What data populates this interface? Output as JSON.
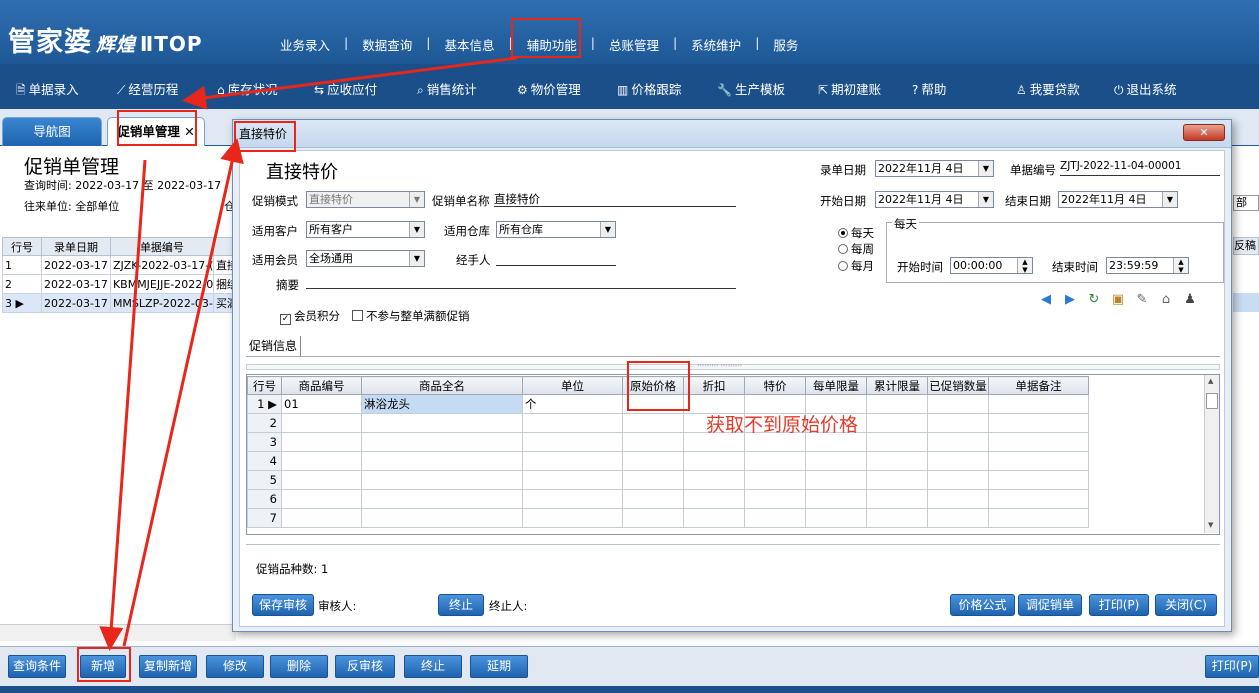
{
  "app": {
    "logo_main": "管家婆",
    "logo_sub": "辉煌",
    "logo_sub2": "ⅡTOP",
    "top_menu": [
      "业务录入",
      "数据查询",
      "基本信息",
      "辅助功能",
      "总账管理",
      "系统维护",
      "服务"
    ]
  },
  "toolbar": {
    "items": [
      {
        "icon": "document-icon",
        "label": "单据录入"
      },
      {
        "icon": "chart-icon",
        "label": "经营历程"
      },
      {
        "icon": "home-icon",
        "label": "库存状况"
      },
      {
        "icon": "transfer-icon",
        "label": "应收应付"
      },
      {
        "icon": "search-icon",
        "label": "销售统计"
      },
      {
        "icon": "gear-icon",
        "label": "物价管理"
      },
      {
        "icon": "bar-chart-icon",
        "label": "价格跟踪"
      },
      {
        "icon": "wrench-icon",
        "label": "生产模板"
      },
      {
        "icon": "export-icon",
        "label": "期初建账"
      },
      {
        "icon": "question-icon",
        "label": "帮助"
      },
      {
        "icon": "person-icon",
        "label": "我要贷款"
      },
      {
        "icon": "power-icon",
        "label": "退出系统"
      }
    ]
  },
  "tabs": {
    "nav": "导航图",
    "promo": "促销单管理",
    "close": "✕"
  },
  "backpage": {
    "title": "促销单管理",
    "query_time_label": "查询时间:",
    "query_from": "2022-03-17",
    "query_to_label": "至",
    "query_to": "2022-03-17",
    "partner_label": "往来单位:",
    "partner_value": "全部单位",
    "partner_tail": "仓",
    "right_field": "部",
    "columns": [
      "行号",
      "录单日期",
      "单据编号",
      ""
    ],
    "right_header": "反稿",
    "rows": [
      {
        "no": "1",
        "date": "2022-03-17",
        "code": "ZJZK-2022-03-17-(",
        "name": "直接"
      },
      {
        "no": "2",
        "date": "2022-03-17",
        "code": "KBMMJEJJE-2022-0:",
        "name": "捆绑"
      },
      {
        "no": "3",
        "date": "2022-03-17",
        "code": "MMSLZP-2022-03-1",
        "name": "买满"
      }
    ]
  },
  "bottom_buttons": [
    "查询条件",
    "新增",
    "复制新增",
    "修改",
    "删除",
    "反审核",
    "终止",
    "延期"
  ],
  "bottom_print": "打印(P)",
  "dialog": {
    "title": "直接特价",
    "heading": "直接特价",
    "record_date_label": "录单日期",
    "record_date": "2022年11月 4日",
    "bill_no_label": "单据编号",
    "bill_no": "ZJTJ-2022-11-04-00001",
    "mode_label": "促销模式",
    "mode_value": "直接特价",
    "name_label": "促销单名称",
    "name_value": "直接特价",
    "start_date_label": "开始日期",
    "start_date": "2022年11月 4日",
    "end_date_label": "结束日期",
    "end_date": "2022年11月 4日",
    "customer_label": "适用客户",
    "customer_value": "所有客户",
    "warehouse_label": "适用仓库",
    "warehouse_value": "所有仓库",
    "member_label": "适用会员",
    "member_value": "全场通用",
    "handler_label": "经手人",
    "summary_label": "摘要",
    "radio_daily": "每天",
    "radio_weekly": "每周",
    "radio_monthly": "每月",
    "group_title": "每天",
    "start_time_label": "开始时间",
    "start_time": "00:00:00",
    "end_time_label": "结束时间",
    "end_time": "23:59:59",
    "chk_member_points": "会员积分",
    "chk_no_full_promo": "不参与整单满额促销",
    "subtab": "促销信息",
    "splitter": "›››››››››   ›››››››››",
    "grid_columns": [
      "行号",
      "商品编号",
      "商品全名",
      "单位",
      "原始价格",
      "折扣",
      "特价",
      "每单限量",
      "累计限量",
      "已促销数量",
      "单据备注"
    ],
    "grid_rows": [
      {
        "no": "1",
        "code": "01",
        "name": "淋浴龙头",
        "unit": "个"
      },
      {
        "no": "2",
        "code": "",
        "name": "",
        "unit": ""
      },
      {
        "no": "3",
        "code": "",
        "name": "",
        "unit": ""
      },
      {
        "no": "4",
        "code": "",
        "name": "",
        "unit": ""
      },
      {
        "no": "5",
        "code": "",
        "name": "",
        "unit": ""
      },
      {
        "no": "6",
        "code": "",
        "name": "",
        "unit": ""
      },
      {
        "no": "7",
        "code": "",
        "name": "",
        "unit": ""
      }
    ],
    "annotation": "获取不到原始价格",
    "count_label": "促销品种数:",
    "count_value": "1",
    "btn_save_audit": "保存审核",
    "auditor_label": "审核人:",
    "btn_terminate": "终止",
    "terminator_label": "终止人:",
    "btn_formula": "价格公式",
    "btn_adjust": "调促销单",
    "btn_print": "打印(P)",
    "btn_close": "关闭(C)",
    "close_x": "✕"
  },
  "colors": {
    "highlight": "#e8261a",
    "annotation": "#e83a2a",
    "topbar": "#1e5896",
    "button": "#1f63ae"
  }
}
